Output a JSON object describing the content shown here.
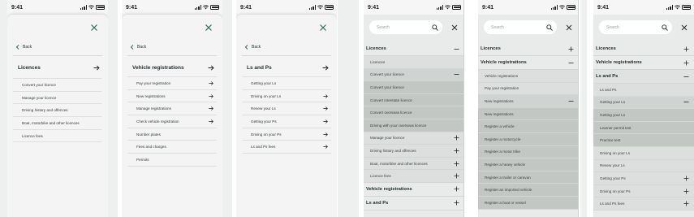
{
  "status_time": "9:41",
  "screens": [
    {
      "back_label": "Back",
      "title": "Licences",
      "items": [
        {
          "label": "Convert your licence",
          "arrow": false
        },
        {
          "label": "Manage your licence",
          "arrow": false
        },
        {
          "label": "Driving history and offences",
          "arrow": false
        },
        {
          "label": "Boat, motorbike and other licences",
          "arrow": false
        },
        {
          "label": "Licence fees",
          "arrow": false
        }
      ]
    },
    {
      "back_label": "Back",
      "title": "Vehicle registrations",
      "items": [
        {
          "label": "Pay your registration",
          "arrow": true
        },
        {
          "label": "New registrations",
          "arrow": true
        },
        {
          "label": "Manage registrations",
          "arrow": true
        },
        {
          "label": "Check vehicle registration",
          "arrow": true
        },
        {
          "label": "Number plates",
          "arrow": false
        },
        {
          "label": "Fees and charges",
          "arrow": false
        },
        {
          "label": "Permits",
          "arrow": false
        }
      ]
    },
    {
      "back_label": "Back",
      "title": "Ls and Ps",
      "items": [
        {
          "label": "Getting your Ls",
          "arrow": false
        },
        {
          "label": "Driving on your Ls",
          "arrow": true
        },
        {
          "label": "Renew your Ls",
          "arrow": true
        },
        {
          "label": "Getting your Ps",
          "arrow": true
        },
        {
          "label": "Driving on your Ps",
          "arrow": true
        },
        {
          "label": "Ls and Ps fees",
          "arrow": true
        }
      ]
    }
  ],
  "menus": [
    {
      "search_placeholder": "Search",
      "rows": [
        {
          "label": "Licences",
          "level": 0,
          "sign": "minus"
        },
        {
          "label": "Licences",
          "level": 1,
          "sign": ""
        },
        {
          "label": "Convert your licence",
          "level": 1,
          "sign": "minus",
          "open": true
        },
        {
          "label": "Convert your licence",
          "level": 2,
          "sign": ""
        },
        {
          "label": "Convert interstate licence",
          "level": 2,
          "sign": ""
        },
        {
          "label": "Convert overseas licence",
          "level": 2,
          "sign": ""
        },
        {
          "label": "Driving with your overseas licence",
          "level": 2,
          "sign": ""
        },
        {
          "label": "Manage your licence",
          "level": 1,
          "sign": "plus"
        },
        {
          "label": "Driving history and offences",
          "level": 1,
          "sign": "plus"
        },
        {
          "label": "Boat, motorbike and other licences",
          "level": 1,
          "sign": "plus"
        },
        {
          "label": "Licence fees",
          "level": 1,
          "sign": "plus"
        },
        {
          "label": "Vehicle registrations",
          "level": 0,
          "sign": "plus"
        },
        {
          "label": "Ls and Ps",
          "level": 0,
          "sign": "plus"
        }
      ]
    },
    {
      "search_placeholder": "Search",
      "rows": [
        {
          "label": "Licences",
          "level": 0,
          "sign": "plus"
        },
        {
          "label": "Vehicle registrations",
          "level": 0,
          "sign": "minus"
        },
        {
          "label": "Vehicle registrations",
          "level": 1,
          "sign": ""
        },
        {
          "label": "Pay your registration",
          "level": 1,
          "sign": ""
        },
        {
          "label": "New registrations",
          "level": 1,
          "sign": "minus",
          "open": true
        },
        {
          "label": "New registrations",
          "level": 2,
          "sign": ""
        },
        {
          "label": "Register a vehicle",
          "level": 2,
          "sign": ""
        },
        {
          "label": "Register a motorcycle",
          "level": 2,
          "sign": ""
        },
        {
          "label": "Register a motor trike",
          "level": 2,
          "sign": ""
        },
        {
          "label": "Register a heavy vehicle",
          "level": 2,
          "sign": ""
        },
        {
          "label": "Register a trailer or caravan",
          "level": 2,
          "sign": ""
        },
        {
          "label": "Register an imported vehicle",
          "level": 2,
          "sign": ""
        },
        {
          "label": "Register a boat or vessel",
          "level": 2,
          "sign": ""
        }
      ]
    },
    {
      "search_placeholder": "Search",
      "rows": [
        {
          "label": "Licences",
          "level": 0,
          "sign": "plus"
        },
        {
          "label": "Vehicle registrations",
          "level": 0,
          "sign": "plus"
        },
        {
          "label": "Ls and Ps",
          "level": 0,
          "sign": "minus",
          "shade": true
        },
        {
          "label": "Ls and Ps",
          "level": 1,
          "sign": ""
        },
        {
          "label": "Getting your Ls",
          "level": 1,
          "sign": "minus",
          "open": true
        },
        {
          "label": "Getting your Ls",
          "level": 2,
          "sign": ""
        },
        {
          "label": "Learner permit test",
          "level": 2,
          "sign": ""
        },
        {
          "label": "Practice test",
          "level": 2,
          "sign": ""
        },
        {
          "label": "Driving on your Ls",
          "level": 1,
          "sign": ""
        },
        {
          "label": "Renew your Ls",
          "level": 1,
          "sign": ""
        },
        {
          "label": "Getting your Ps",
          "level": 1,
          "sign": "plus"
        },
        {
          "label": "Driving on your Ps",
          "level": 1,
          "sign": "plus"
        },
        {
          "label": "Ls and Ps fees",
          "level": 1,
          "sign": "plus"
        }
      ]
    }
  ]
}
